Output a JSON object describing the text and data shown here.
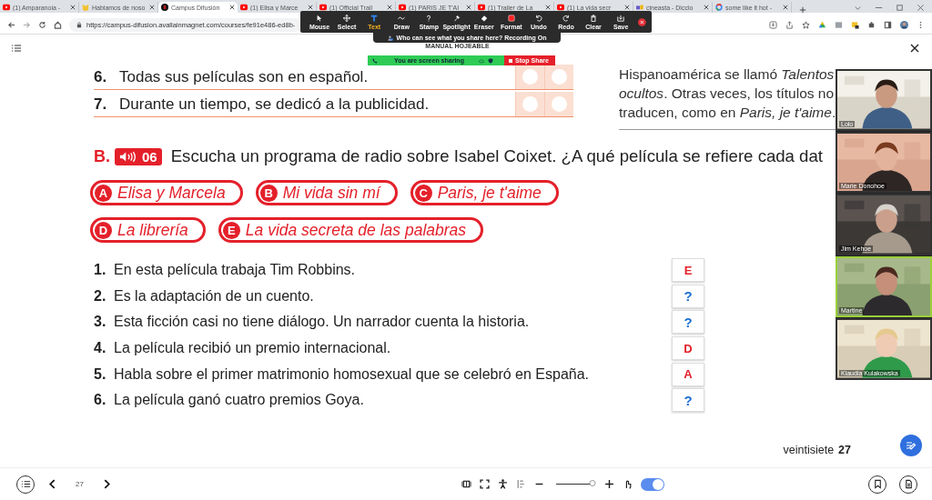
{
  "browser": {
    "tabs": [
      {
        "title": "(1) Amparanoia -",
        "kind": "play",
        "selected": false
      },
      {
        "title": "Hablamos de noso",
        "kind": "cat",
        "selected": false
      },
      {
        "title": "Campus Difusión",
        "kind": "disc",
        "selected": true
      },
      {
        "title": "(1) Elisa y Marce",
        "kind": "play",
        "selected": false
      },
      {
        "title": "(1) Official Trail",
        "kind": "play",
        "selected": false
      },
      {
        "title": "(1) PARIS JE T'AI",
        "kind": "play",
        "selected": false
      },
      {
        "title": "(1) Trailer de La",
        "kind": "play",
        "selected": false
      },
      {
        "title": "(1) La vida secr",
        "kind": "play",
        "selected": false
      },
      {
        "title": "cineasta - Diccio",
        "kind": "blocks",
        "selected": false
      },
      {
        "title": "some like it hot -",
        "kind": "ring",
        "selected": false
      }
    ],
    "url": "https://campus-difusion.avallainmagnet.com/courses/fe91e486-ed8b-"
  },
  "annotation_toolbar": {
    "tools": [
      {
        "label": "Mouse",
        "kind": "pointer",
        "selected": false
      },
      {
        "label": "Select",
        "kind": "move",
        "selected": false
      },
      {
        "label": "Text",
        "kind": "text",
        "selected": true
      },
      {
        "label": "Draw",
        "kind": "wave",
        "selected": false
      },
      {
        "label": "Stamp",
        "kind": "question",
        "selected": false
      },
      {
        "label": "Spotlight",
        "kind": "spotlight",
        "selected": false
      },
      {
        "label": "Eraser",
        "kind": "eraser",
        "selected": false
      },
      {
        "label": "Format",
        "kind": "swatch",
        "selected": false
      },
      {
        "label": "Undo",
        "kind": "undo",
        "selected": false
      },
      {
        "label": "Redo",
        "kind": "redo",
        "selected": false
      },
      {
        "label": "Clear",
        "kind": "trash",
        "selected": false
      },
      {
        "label": "Save",
        "kind": "save",
        "selected": false
      }
    ]
  },
  "recording_notice": "Who can see what you share here? Recording On",
  "viewer_title": "MANUAL HOJEABLE",
  "share_bar": {
    "status": "You are screen sharing",
    "stop_button": "Stop Share"
  },
  "book": {
    "statements": [
      {
        "num": "6.",
        "text": "Todas sus películas son en español.",
        "choices": [
          {
            "checked": false
          },
          {
            "checked": false
          }
        ]
      },
      {
        "num": "7.",
        "text": "Durante un tiempo, se dedicó a la publicidad.",
        "choices": [
          {
            "checked": false
          },
          {
            "checked": false
          }
        ]
      }
    ],
    "side_note": [
      "Hispanoamérica se llamó *Talentos*",
      "*ocultos*. Otras veces, los títulos no",
      "traducen, como en *Paris, je t'aime*."
    ],
    "section": {
      "letter": "B.",
      "track": "06",
      "instruction": "Escucha un programa de radio sobre Isabel Coixet. ¿A qué película se refiere cada dat"
    },
    "film_rows": [
      [
        {
          "letter": "A",
          "title": "Elisa y Marcela"
        },
        {
          "letter": "B",
          "title": "Mi vida sin mí"
        },
        {
          "letter": "C",
          "title": "Paris, je t'aime"
        }
      ],
      [
        {
          "letter": "D",
          "title": "La librería"
        },
        {
          "letter": "E",
          "title": "La vida secreta de las palabras"
        }
      ]
    ],
    "items": [
      {
        "num": "1.",
        "text": "En esta película trabaja Tim Robbins.",
        "answer": "E",
        "kind": "letter"
      },
      {
        "num": "2.",
        "text": "Es la adaptación de un cuento.",
        "answer": "?",
        "kind": "question"
      },
      {
        "num": "3.",
        "text": "Esta ficción casi no tiene diálogo. Un narrador cuenta la historia.",
        "answer": "?",
        "kind": "question"
      },
      {
        "num": "4.",
        "text": "La película recibió un premio internacional.",
        "answer": "D",
        "kind": "letter"
      },
      {
        "num": "5.",
        "text": "Habla sobre el primer matrimonio homosexual que se celebró en España.",
        "answer": "A",
        "kind": "letter"
      },
      {
        "num": "6.",
        "text": "La película ganó cuatro premios Goya.",
        "answer": "?",
        "kind": "question"
      }
    ],
    "footer": {
      "page_word": "veintisiete",
      "page_number": "27"
    }
  },
  "participants": [
    {
      "name": "Lolo",
      "speaking": false
    },
    {
      "name": "Marie Donohoe",
      "speaking": false
    },
    {
      "name": "Jim Kehoe",
      "speaking": false
    },
    {
      "name": "Martine",
      "speaking": true
    },
    {
      "name": "Klaudia Kulakowska",
      "speaking": false
    }
  ],
  "bottom_bar": {
    "page": "27",
    "zoom": {
      "level": 1
    },
    "touch_toggle": {
      "on": true
    }
  }
}
